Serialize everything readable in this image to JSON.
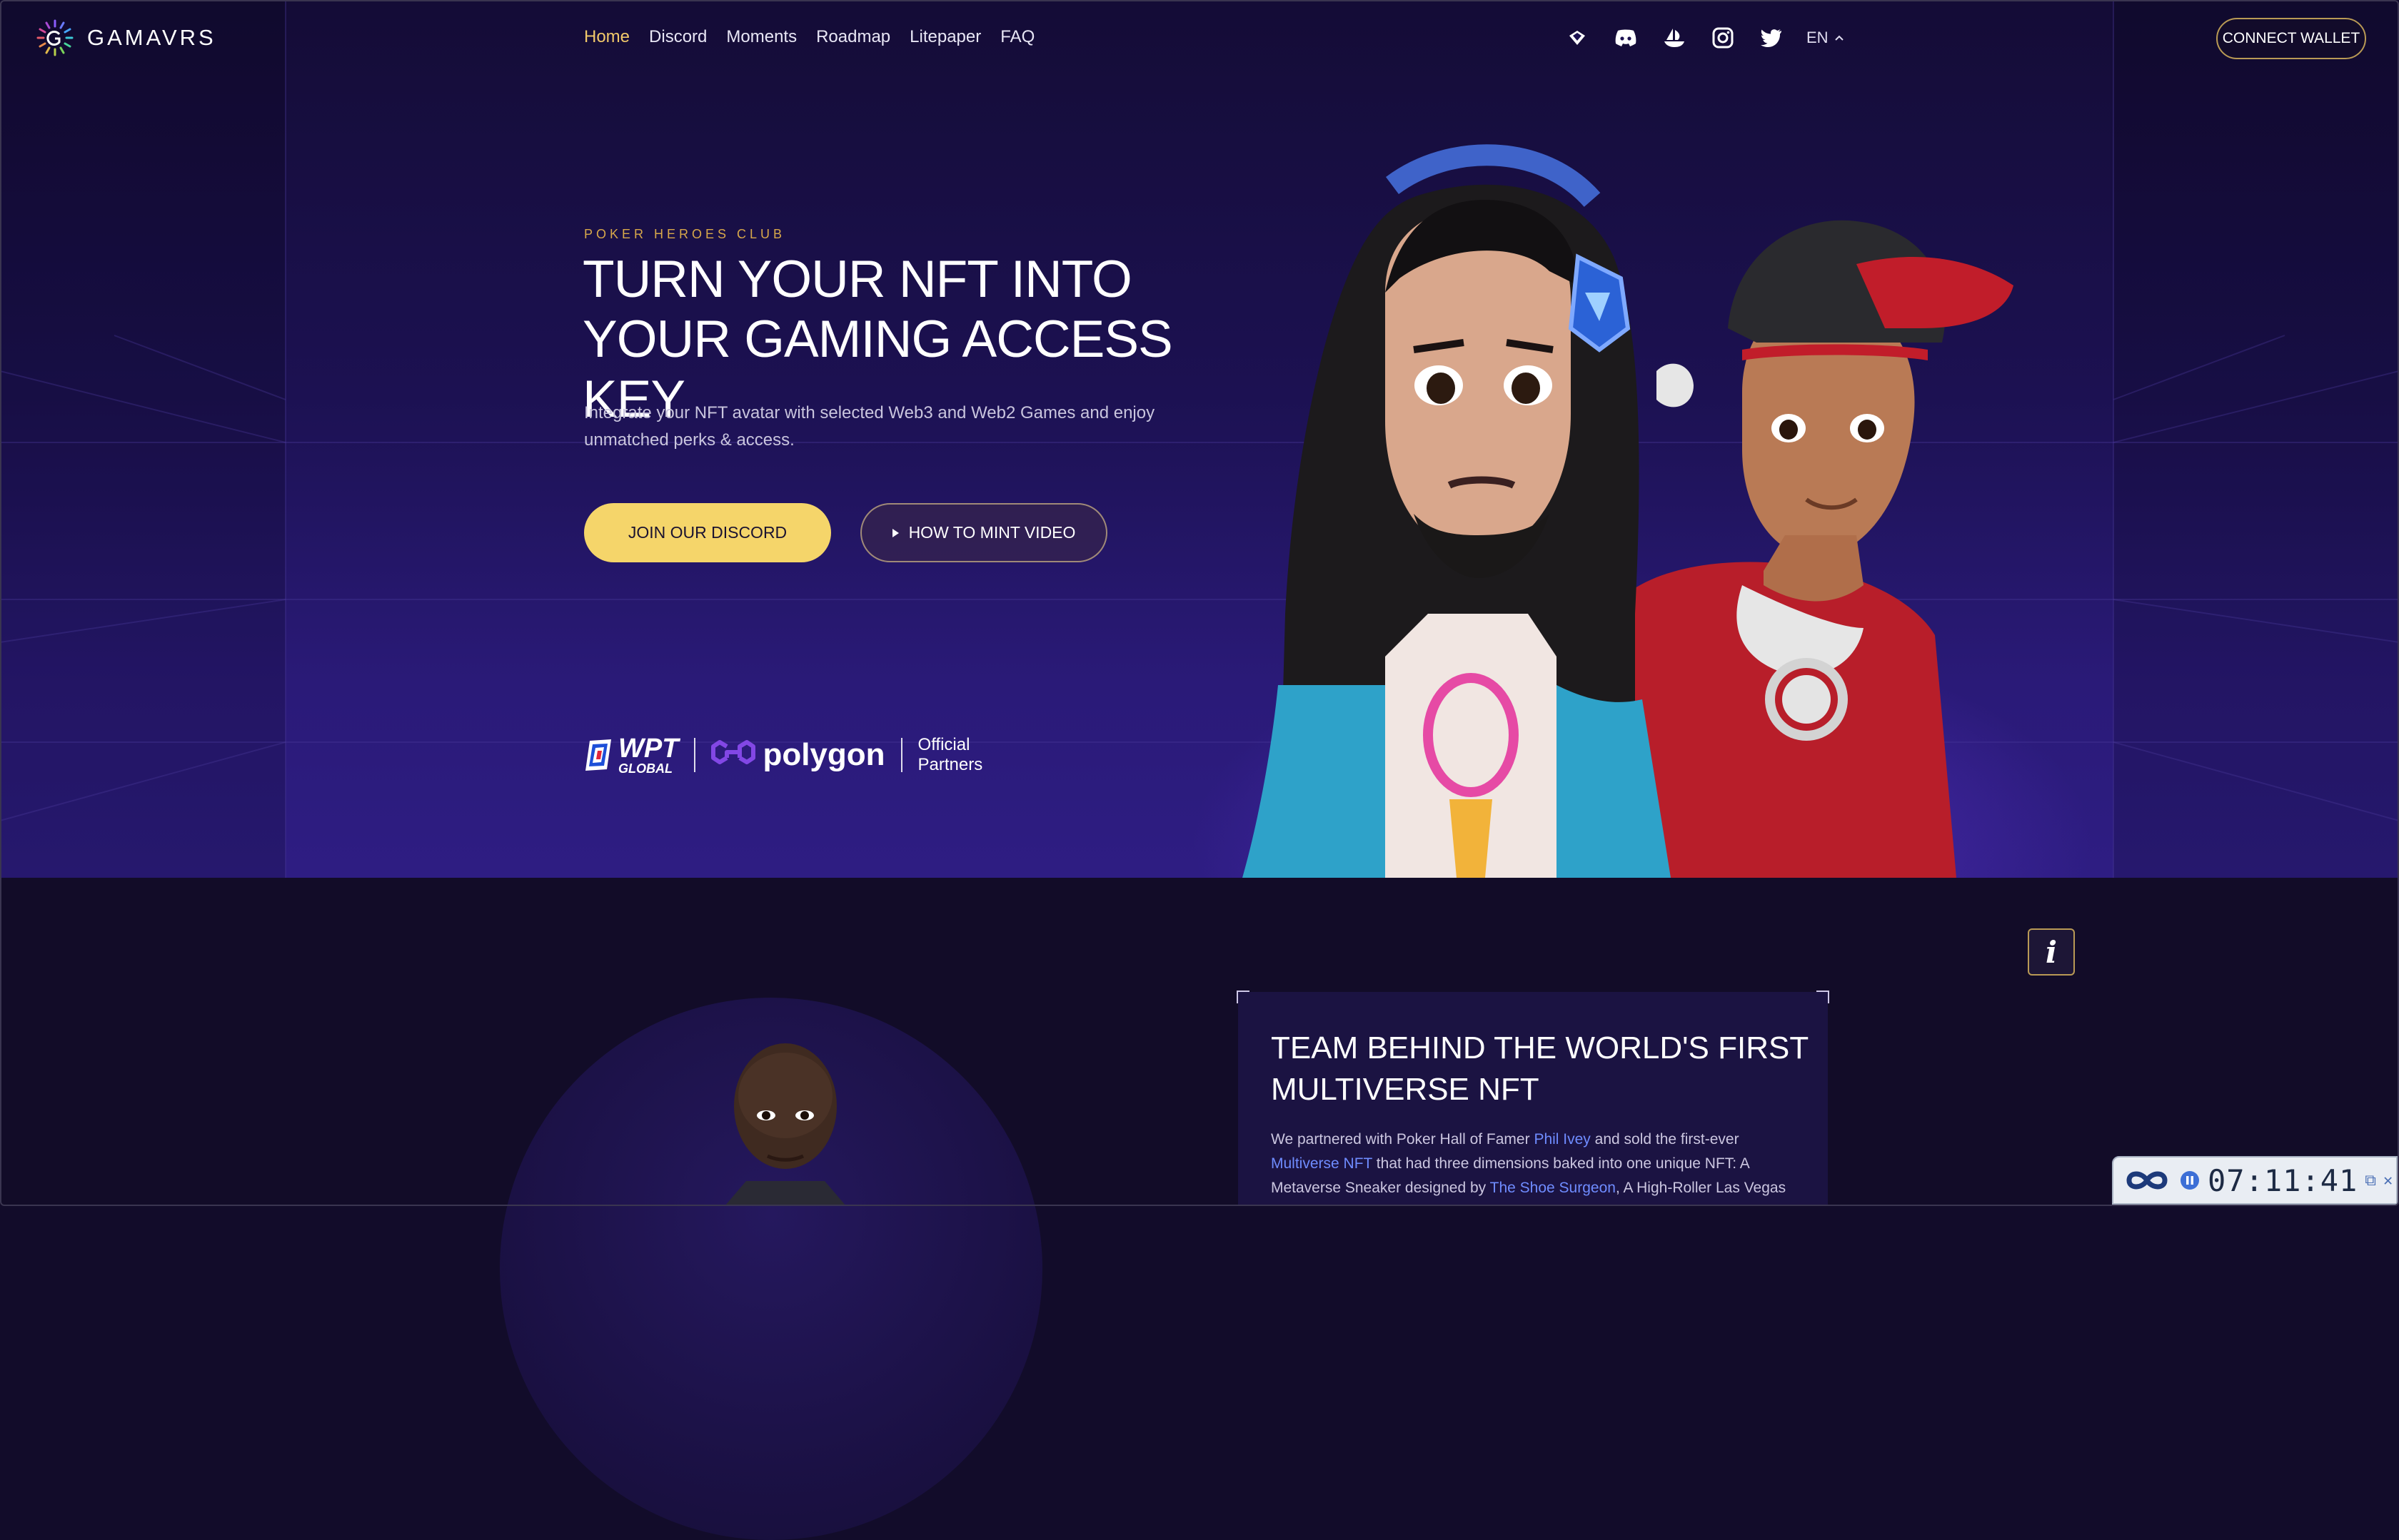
{
  "brand": {
    "name": "GAMAVRS"
  },
  "nav": {
    "items": [
      {
        "label": "Home",
        "active": true
      },
      {
        "label": "Discord",
        "active": false
      },
      {
        "label": "Moments",
        "active": false
      },
      {
        "label": "Roadmap",
        "active": false
      },
      {
        "label": "Litepaper",
        "active": false
      },
      {
        "label": "FAQ",
        "active": false
      }
    ],
    "socials": [
      "gitbook-icon",
      "discord-icon",
      "opensea-icon",
      "instagram-icon",
      "twitter-icon"
    ],
    "language": "EN",
    "connect_label": "CONNECT WALLET"
  },
  "hero": {
    "eyebrow": "POKER HEROES CLUB",
    "headline": "TURN YOUR NFT INTO YOUR GAMING ACCESS KEY",
    "subtitle": "Integrate your NFT avatar with selected Web3 and Web2 Games and enjoy unmatched perks & access.",
    "primary_cta": "JOIN OUR DISCORD",
    "secondary_cta": "HOW TO MINT VIDEO",
    "partners": {
      "wpt_big": "WPT",
      "wpt_small": "GLOBAL",
      "polygon": "polygon",
      "label_line1": "Official",
      "label_line2": "Partners"
    }
  },
  "team": {
    "info_icon": "i",
    "title": "TEAM BEHIND THE WORLD'S FIRST MULTIVERSE NFT",
    "text": {
      "p1": "We partnered with Poker Hall of Famer ",
      "link1": "Phil Ivey",
      "p2": " and sold the first-ever ",
      "link2": "Multiverse NFT",
      "p3": " that had three dimensions baked into one unique NFT: A Metaverse Sneaker designed by ",
      "link3": "The Shoe Surgeon",
      "p4": ", A High-Roller Las Vegas"
    }
  },
  "recorder": {
    "time": "07:11:41"
  },
  "colors": {
    "accent": "#f5d56a",
    "nav_active": "#f2c96a",
    "link": "#6f8cff",
    "background": "#120c2a"
  }
}
